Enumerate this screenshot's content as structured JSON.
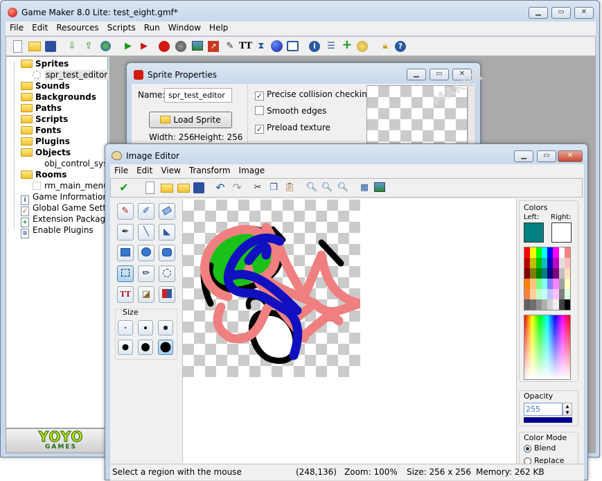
{
  "main_window": {
    "title": "Game Maker 8.0 Lite: test_eight.gmf*",
    "menu": [
      "File",
      "Edit",
      "Resources",
      "Scripts",
      "Run",
      "Window",
      "Help"
    ],
    "toolbar_icons": [
      "new-icon",
      "open-icon",
      "save-icon",
      "create-executable-icon",
      "publish-icon",
      "web-icon",
      "run-icon",
      "debug-icon",
      "sprite-icon",
      "sound-icon",
      "background-icon",
      "path-icon",
      "script-icon",
      "font-icon",
      "timeline-icon",
      "object-icon",
      "room-icon",
      "game-info-icon",
      "global-settings-icon",
      "extension-icon",
      "plugins-icon",
      "lock-icon",
      "help-icon"
    ]
  },
  "tree": [
    {
      "label": "Sprites",
      "type": "folder",
      "bold": true
    },
    {
      "label": "spr_test_editor",
      "type": "sprite",
      "bold": false
    },
    {
      "label": "Sounds",
      "type": "folder",
      "bold": true
    },
    {
      "label": "Backgrounds",
      "type": "folder",
      "bold": true
    },
    {
      "label": "Paths",
      "type": "folder",
      "bold": true
    },
    {
      "label": "Scripts",
      "type": "folder",
      "bold": true
    },
    {
      "label": "Fonts",
      "type": "folder",
      "bold": true
    },
    {
      "label": "Plugins",
      "type": "folder",
      "bold": true
    },
    {
      "label": "Objects",
      "type": "folder",
      "bold": true
    },
    {
      "label": "obj_control_syste",
      "type": "object",
      "bold": false
    },
    {
      "label": "Rooms",
      "type": "folder",
      "bold": true
    },
    {
      "label": "rm_main_menu",
      "type": "room",
      "bold": false
    },
    {
      "label": "Game Information",
      "type": "item",
      "bold": false
    },
    {
      "label": "Global Game Setting",
      "type": "item",
      "bold": false
    },
    {
      "label": "Extension Packages",
      "type": "item",
      "bold": false
    },
    {
      "label": "Enable Plugins",
      "type": "item",
      "bold": false
    }
  ],
  "logo": {
    "line1": "YOYO",
    "line2": "GAMES"
  },
  "sprite_props": {
    "title": "Sprite Properties",
    "name_label": "Name:",
    "name_value": "spr_test_editor",
    "load_button": "Load Sprite",
    "width_label": "Width: 256",
    "height_label": "Height: 256",
    "options": [
      {
        "label": "Precise collision checking",
        "checked": true
      },
      {
        "label": "Smooth edges",
        "checked": false
      },
      {
        "label": "Preload texture",
        "checked": true
      }
    ],
    "watermark": "MAKER"
  },
  "image_editor": {
    "title": "Image Editor",
    "menu": [
      "File",
      "Edit",
      "View",
      "Transform",
      "Image"
    ],
    "size_label": "Size",
    "colors_label": "Colors",
    "left_label": "Left:",
    "right_label": "Right:",
    "left_color": "#008080",
    "right_color": "#ffffff",
    "opacity_label": "Opacity",
    "opacity_value": "255",
    "color_mode_label": "Color Mode",
    "blend_label": "Blend",
    "replace_label": "Replace",
    "blend_selected": true
  },
  "status": {
    "hint": "Select a region with the mouse",
    "coords": "(248,136)",
    "zoom": "Zoom: 100%",
    "size": "Size: 256 x 256",
    "memory": "Memory: 262 KB"
  },
  "palette": [
    "#ff0000",
    "#ffff00",
    "#00ff00",
    "#00ffff",
    "#0000ff",
    "#ff00ff",
    "#ffffff",
    "#ff8080",
    "#c00000",
    "#c0c000",
    "#00c000",
    "#00c0c0",
    "#0000c0",
    "#c000c0",
    "#e0e0e0",
    "#ffc0c0",
    "#800000",
    "#808000",
    "#008000",
    "#008080",
    "#000080",
    "#800080",
    "#c0c0c0",
    "#ffe0c0",
    "#ff8000",
    "#ffc080",
    "#80ff80",
    "#80ffff",
    "#8080ff",
    "#ff80ff",
    "#a0a0a0",
    "#ffffc0",
    "#ff8040",
    "#ffd0a0",
    "#c0ffc0",
    "#c0ffff",
    "#c0c0ff",
    "#ffc0ff",
    "#808080",
    "#e0ffe0",
    "#606060",
    "#707070",
    "#909090",
    "#b0b0b0",
    "#d0d0d0",
    "#f0f0f0",
    "#404040",
    "#000000"
  ]
}
